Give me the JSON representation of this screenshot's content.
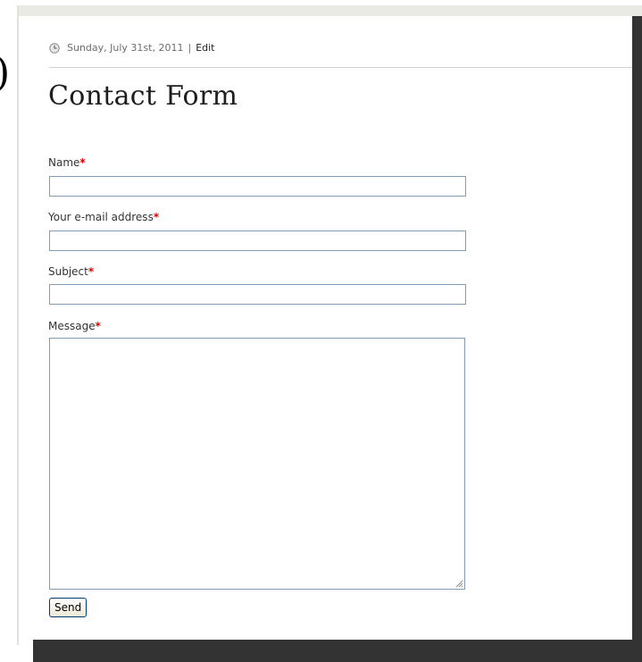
{
  "post_meta": {
    "date": "Sunday, July 31st, 2011",
    "separator": "|",
    "edit_link": "Edit"
  },
  "page": {
    "title": "Contact Form"
  },
  "form": {
    "required_marker": "*",
    "fields": [
      {
        "label": "Name",
        "value": ""
      },
      {
        "label": "Your e-mail address",
        "value": ""
      },
      {
        "label": "Subject",
        "value": ""
      },
      {
        "label": "Message",
        "value": ""
      }
    ],
    "send_label": "Send"
  },
  "icons": {
    "date": "clock-icon",
    "resize": "resize-grip-icon"
  },
  "colors": {
    "required": "#e00000",
    "input_border": "#7f9db9",
    "frame_shadow": "#333333"
  }
}
